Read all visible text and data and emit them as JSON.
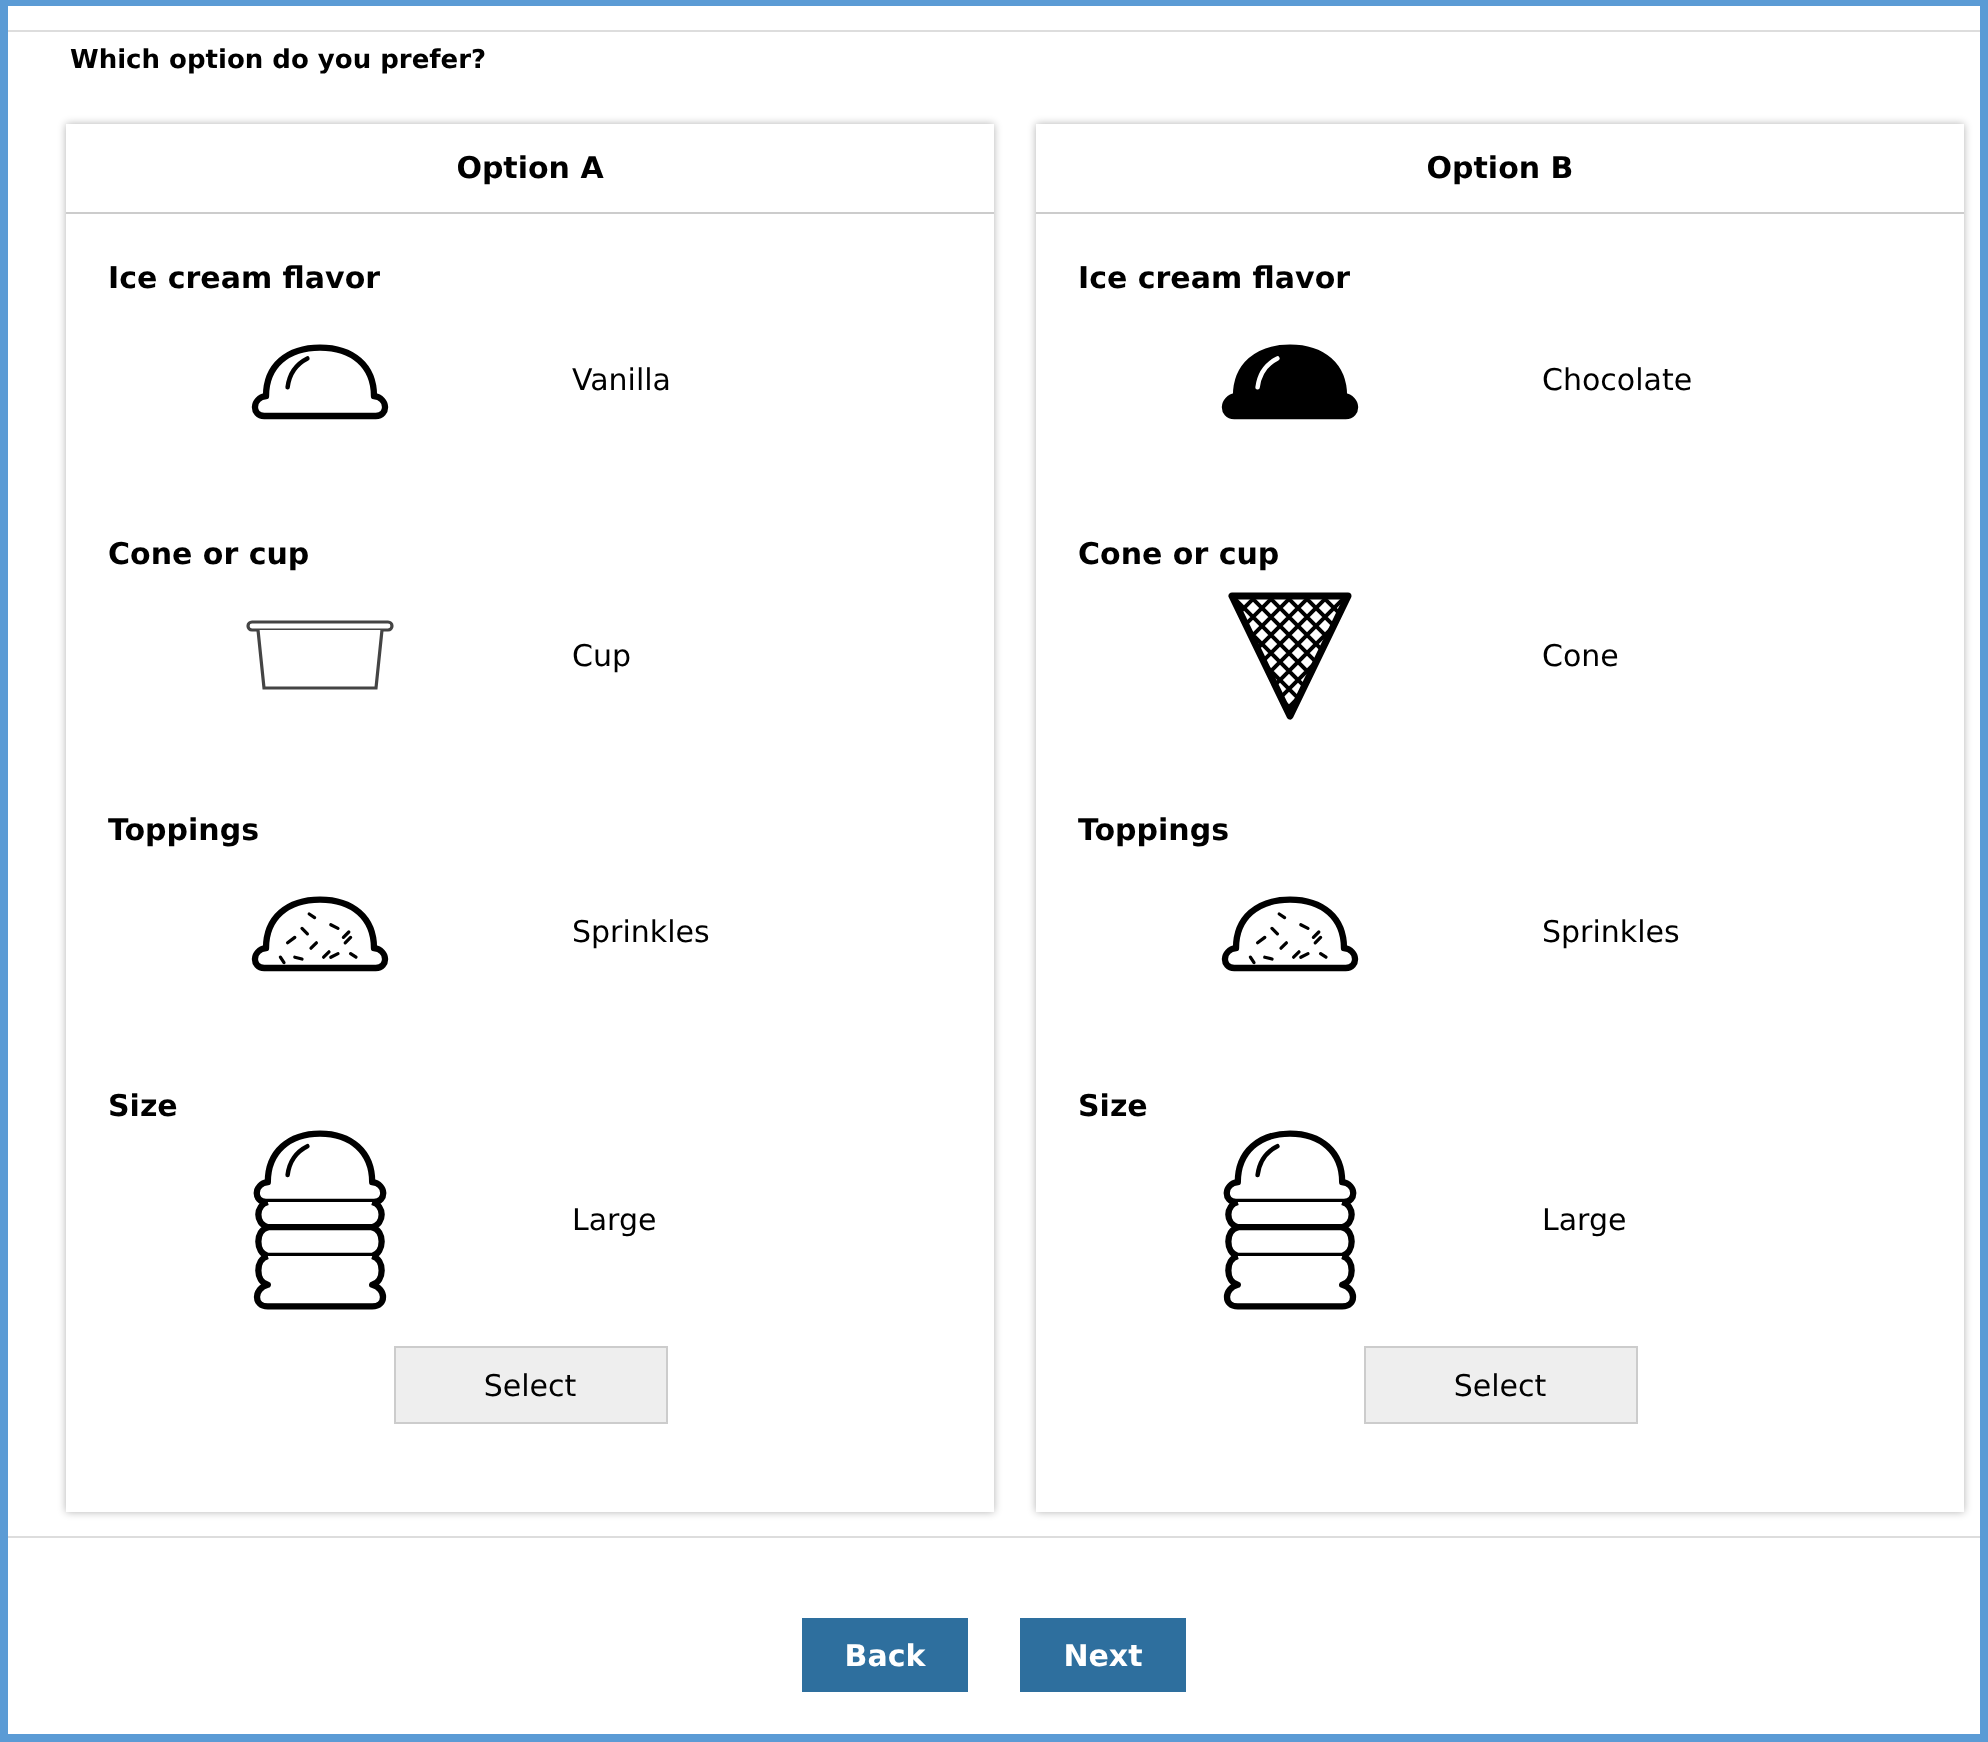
{
  "question": "Which option do you prefer?",
  "options": [
    {
      "title": "Option A",
      "attributes": [
        {
          "label": "Ice cream flavor",
          "kind": "scoop",
          "value": "Vanilla"
        },
        {
          "label": "Cone or cup",
          "kind": "cup",
          "value": "Cup"
        },
        {
          "label": "Toppings",
          "kind": "sprinkles",
          "value": "Sprinkles"
        },
        {
          "label": "Size",
          "kind": "stack",
          "value": "Large"
        }
      ],
      "button": "Select"
    },
    {
      "title": "Option B",
      "attributes": [
        {
          "label": "Ice cream flavor",
          "kind": "darkscoop",
          "value": "Chocolate"
        },
        {
          "label": "Cone or cup",
          "kind": "cone",
          "value": "Cone"
        },
        {
          "label": "Toppings",
          "kind": "sprinkles",
          "value": "Sprinkles"
        },
        {
          "label": "Size",
          "kind": "stack",
          "value": "Large"
        }
      ],
      "button": "Select"
    }
  ],
  "nav": [
    "Back",
    "Next"
  ]
}
